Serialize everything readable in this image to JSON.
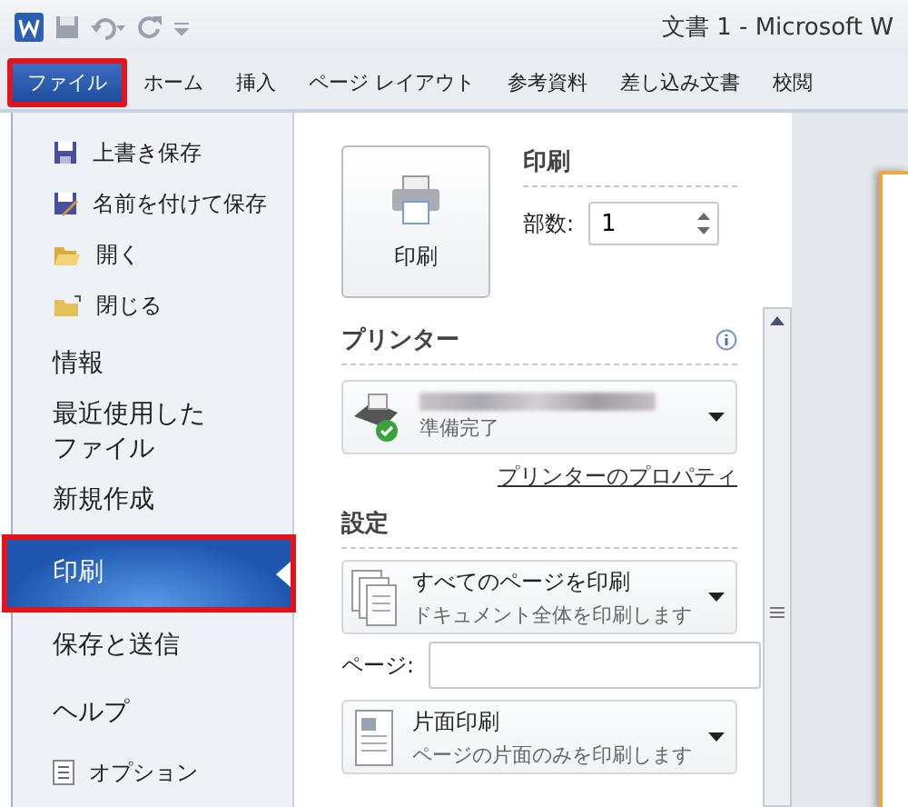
{
  "window": {
    "title": "文書 1 - Microsoft W"
  },
  "tabs": [
    {
      "label": "ファイル",
      "selected": true
    },
    {
      "label": "ホーム",
      "selected": false
    },
    {
      "label": "挿入",
      "selected": false
    },
    {
      "label": "ページ レイアウト",
      "selected": false
    },
    {
      "label": "参考資料",
      "selected": false
    },
    {
      "label": "差し込み文書",
      "selected": false
    },
    {
      "label": "校閲",
      "selected": false
    }
  ],
  "sidebar": {
    "items": [
      {
        "kind": "command",
        "label": "上書き保存",
        "selected": false
      },
      {
        "kind": "command",
        "label": "名前を付けて保存",
        "selected": false
      },
      {
        "kind": "command",
        "label": "開く",
        "selected": false
      },
      {
        "kind": "command",
        "label": "閉じる",
        "selected": false
      },
      {
        "kind": "section",
        "label": "情報",
        "selected": false
      },
      {
        "kind": "section",
        "label": "最近使用したファイル",
        "selected": false
      },
      {
        "kind": "section",
        "label": "新規作成",
        "selected": false
      },
      {
        "kind": "section",
        "label": "印刷",
        "selected": true
      },
      {
        "kind": "section",
        "label": "保存と送信",
        "selected": false
      },
      {
        "kind": "section",
        "label": "ヘルプ",
        "selected": false
      },
      {
        "kind": "command",
        "label": "オプション",
        "selected": false
      }
    ]
  },
  "print": {
    "button_label": "印刷",
    "heading": "印刷",
    "copies_label": "部数:",
    "copies_value": "1"
  },
  "printer": {
    "heading": "プリンター",
    "status": "準備完了",
    "properties_link": "プリンターのプロパティ"
  },
  "settings": {
    "heading": "設定",
    "pages_label": "ページ:",
    "dropdowns": [
      {
        "title": "すべてのページを印刷",
        "subtitle": "ドキュメント全体を印刷します"
      },
      {
        "title": "片面印刷",
        "subtitle": "ページの片面のみを印刷します"
      }
    ]
  }
}
